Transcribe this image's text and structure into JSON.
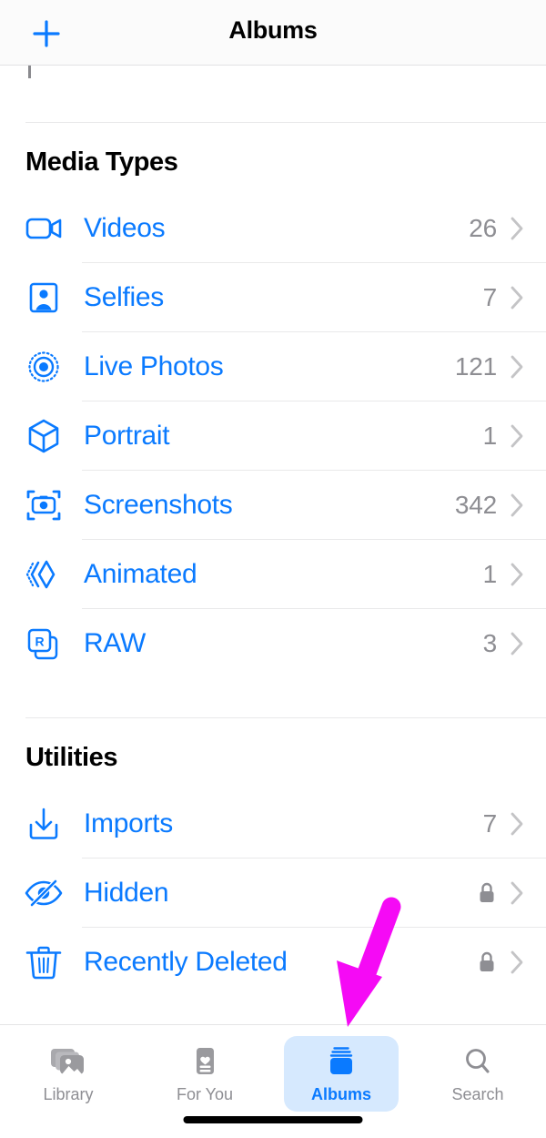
{
  "navbar": {
    "title": "Albums",
    "add_button_icon": "plus-icon"
  },
  "sections": [
    {
      "title": "Media Types",
      "rows": [
        {
          "label": "Videos",
          "count": "26",
          "icon": "video-camera-icon",
          "accessory": "chevron-right-icon"
        },
        {
          "label": "Selfies",
          "count": "7",
          "icon": "person-portrait-icon",
          "accessory": "chevron-right-icon"
        },
        {
          "label": "Live Photos",
          "count": "121",
          "icon": "live-photo-icon",
          "accessory": "chevron-right-icon"
        },
        {
          "label": "Portrait",
          "count": "1",
          "icon": "cube-icon",
          "accessory": "chevron-right-icon"
        },
        {
          "label": "Screenshots",
          "count": "342",
          "icon": "screenshot-camera-icon",
          "accessory": "chevron-right-icon"
        },
        {
          "label": "Animated",
          "count": "1",
          "icon": "animated-frames-icon",
          "accessory": "chevron-right-icon"
        },
        {
          "label": "RAW",
          "count": "3",
          "icon": "raw-badge-icon",
          "accessory": "chevron-right-icon"
        }
      ]
    },
    {
      "title": "Utilities",
      "rows": [
        {
          "label": "Imports",
          "count": "7",
          "icon": "import-download-icon",
          "accessory": "chevron-right-icon"
        },
        {
          "label": "Hidden",
          "count": "",
          "icon": "eye-slash-icon",
          "accessory": "lock-icon",
          "locked": true
        },
        {
          "label": "Recently Deleted",
          "count": "",
          "icon": "trash-icon",
          "accessory": "lock-icon",
          "locked": true
        }
      ]
    }
  ],
  "tabbar": {
    "tabs": [
      {
        "label": "Library",
        "icon": "photo-stack-icon",
        "selected": false
      },
      {
        "label": "For You",
        "icon": "heart-card-icon",
        "selected": false
      },
      {
        "label": "Albums",
        "icon": "albums-stack-icon",
        "selected": true
      },
      {
        "label": "Search",
        "icon": "magnifier-icon",
        "selected": false
      }
    ]
  },
  "annotation": {
    "type": "arrow",
    "color": "#f50af5",
    "points_to": "albums-tab"
  },
  "colors": {
    "accent_blue": "#0a7aff",
    "secondary_gray": "#8e8e93",
    "selected_tab_bg": "#d6e9fe",
    "separator": "#e9e9ea",
    "annotation_magenta": "#f50af5"
  }
}
